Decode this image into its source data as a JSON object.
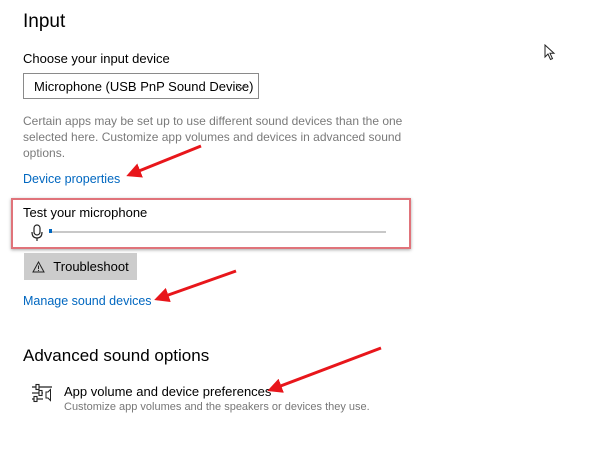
{
  "input": {
    "title": "Input",
    "choose_label": "Choose your input device",
    "device_selected": "Microphone (USB PnP Sound Device)",
    "helper_text": "Certain apps may be set up to use different sound devices than the one selected here. Customize app volumes and devices in advanced sound options.",
    "device_properties_link": "Device properties",
    "test_mic_label": "Test your microphone",
    "mic_level": 0.01,
    "troubleshoot_label": "Troubleshoot",
    "manage_sound_link": "Manage sound devices"
  },
  "advanced": {
    "title": "Advanced sound options",
    "app_volume_title": "App volume and device preferences",
    "app_volume_desc": "Customize app volumes and the speakers or devices they use."
  },
  "colors": {
    "link": "#0067c0",
    "annotation_arrow": "#e8161b",
    "highlight_box": "#e0737a"
  },
  "icons": [
    "chevron-down-icon",
    "microphone-icon",
    "warning-icon",
    "sliders-icon",
    "mouse-cursor-icon",
    "annotation-arrow"
  ]
}
